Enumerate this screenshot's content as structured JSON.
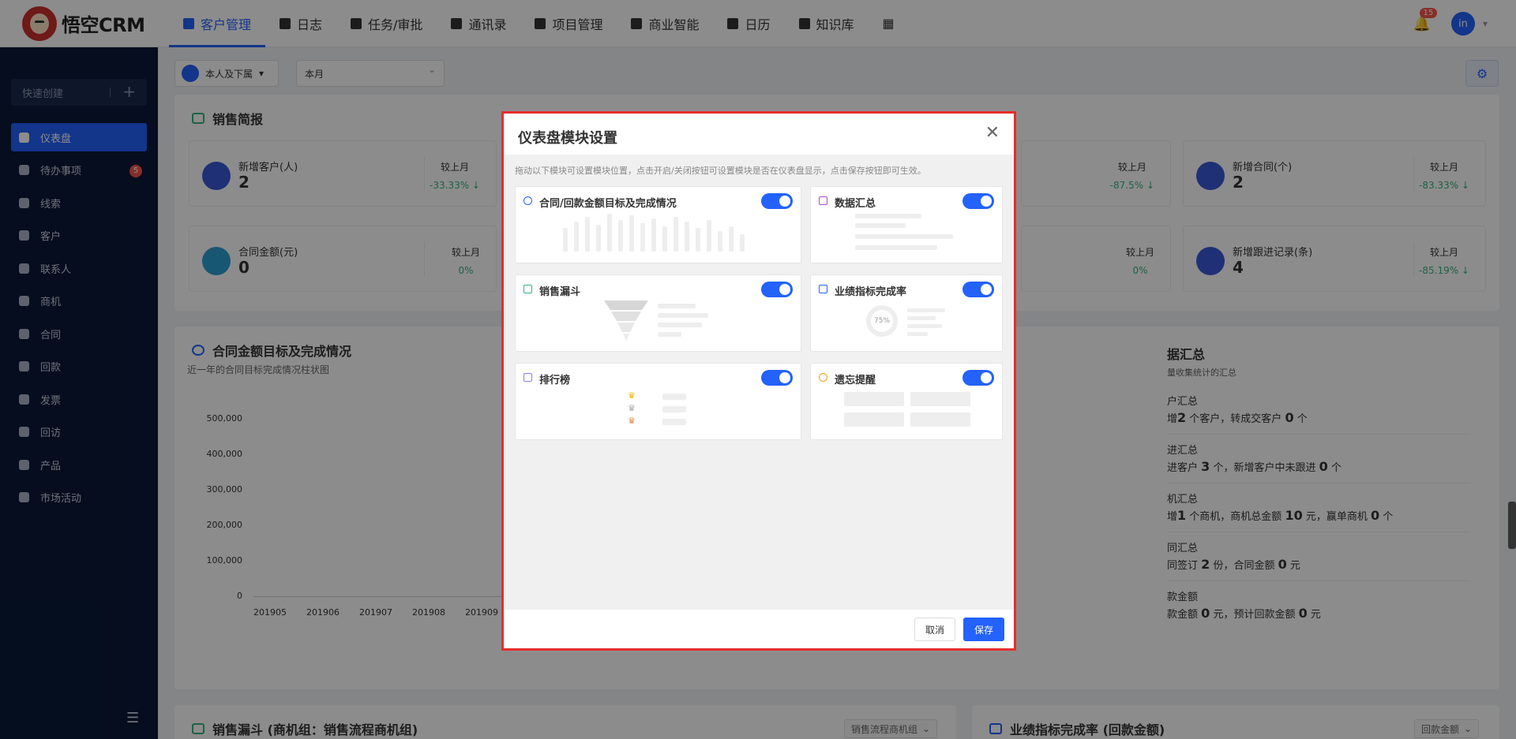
{
  "app": {
    "logo_text": "悟空CRM"
  },
  "nav": {
    "items": [
      {
        "label": "客户管理",
        "icon": "customer-icon",
        "active": true
      },
      {
        "label": "日志",
        "icon": "log-icon"
      },
      {
        "label": "任务/审批",
        "icon": "task-icon"
      },
      {
        "label": "通讯录",
        "icon": "contacts-icon"
      },
      {
        "label": "项目管理",
        "icon": "project-icon"
      },
      {
        "label": "商业智能",
        "icon": "bi-icon"
      },
      {
        "label": "日历",
        "icon": "calendar-icon"
      },
      {
        "label": "知识库",
        "icon": "knowledge-icon"
      }
    ],
    "grid_icon": "apps-grid-icon",
    "notification_count": "15",
    "avatar_text": "in"
  },
  "sidebar": {
    "quick_create": "快速创建",
    "items": [
      {
        "label": "仪表盘",
        "active": true
      },
      {
        "label": "待办事项",
        "badge": "5"
      },
      {
        "label": "线索"
      },
      {
        "label": "客户"
      },
      {
        "label": "联系人"
      },
      {
        "label": "商机"
      },
      {
        "label": "合同"
      },
      {
        "label": "回款"
      },
      {
        "label": "发票"
      },
      {
        "label": "回访"
      },
      {
        "label": "产品"
      },
      {
        "label": "市场活动"
      }
    ]
  },
  "filters": {
    "user_scope": "本人及下属",
    "period": "本月"
  },
  "sales_brief": {
    "title": "销售简报",
    "compare_label": "较上月",
    "stats": [
      {
        "label": "新增客户(人)",
        "value": "2",
        "change": "-33.33% ↓"
      },
      {
        "label": "合同金额(元)",
        "value": "0",
        "change": "0%"
      },
      {
        "label": "新增合同(个)",
        "value": "2",
        "change": "-83.33% ↓"
      },
      {
        "label": "新增跟进记录(条)",
        "value": "4",
        "change": "-85.19% ↓"
      }
    ],
    "partial_changes": [
      "-87.5% ↓",
      "0%"
    ]
  },
  "contract_chart": {
    "title": "合同金额目标及完成情况",
    "subtitle": "近一年的合同目标完成情况柱状图",
    "y_ticks": [
      "500,000",
      "400,000",
      "300,000",
      "200,000",
      "100,000",
      "0"
    ],
    "x_ticks": [
      "201905",
      "201906",
      "201907",
      "201908",
      "201909"
    ]
  },
  "data_summary": {
    "title": "据汇总",
    "subtitle": "量收集统计的汇总",
    "rows": [
      {
        "head": "户汇总",
        "prefix": "增",
        "n1": "2",
        "mid": "个客户，转成交客户",
        "n2": "0",
        "suffix": "个"
      },
      {
        "head": "进汇总",
        "prefix": "进客户",
        "n1": "3",
        "mid": "个，新增客户中未跟进",
        "n2": "0",
        "suffix": "个"
      },
      {
        "head": "机汇总",
        "prefix": "增",
        "n1": "1",
        "mid": "个商机，商机总金额",
        "n2": "10",
        "suffix": "元，赢单商机",
        "n3": "0",
        "suffix2": "个"
      },
      {
        "head": "同汇总",
        "prefix": "同签订",
        "n1": "2",
        "mid": "份，合同金额",
        "n2": "0",
        "suffix": "元"
      },
      {
        "head": "款金额",
        "prefix": "款金额",
        "n1": "0",
        "mid": "元，预计回款金额",
        "n2": "0",
        "suffix": "元"
      }
    ]
  },
  "funnel_panel": {
    "title": "销售漏斗 (商机组：销售流程商机组)",
    "dropdown": "销售流程商机组"
  },
  "performance_panel": {
    "title": "业绩指标完成率 (回款金额)",
    "dropdown": "回款金额"
  },
  "modal": {
    "title": "仪表盘模块设置",
    "description": "拖动以下模块可设置模块位置，点击开启/关闭按钮可设置模块是否在仪表盘显示，点击保存按钮即可生效。",
    "modules": [
      {
        "title": "合同/回款金额目标及完成情况",
        "enabled": true,
        "icon": "target-icon"
      },
      {
        "title": "数据汇总",
        "enabled": true,
        "icon": "data-summary-icon"
      },
      {
        "title": "销售漏斗",
        "enabled": true,
        "icon": "funnel-icon"
      },
      {
        "title": "业绩指标完成率",
        "enabled": true,
        "icon": "performance-icon",
        "preview_value": "75%"
      },
      {
        "title": "排行榜",
        "enabled": true,
        "icon": "ranking-icon"
      },
      {
        "title": "遗忘提醒",
        "enabled": true,
        "icon": "alarm-icon"
      }
    ],
    "cancel_label": "取消",
    "save_label": "保存"
  },
  "colors": {
    "primary": "#2362fb",
    "sidebar_bg": "#0a1937",
    "highlight_border": "#e62d2d",
    "positive": "#36b37e"
  }
}
